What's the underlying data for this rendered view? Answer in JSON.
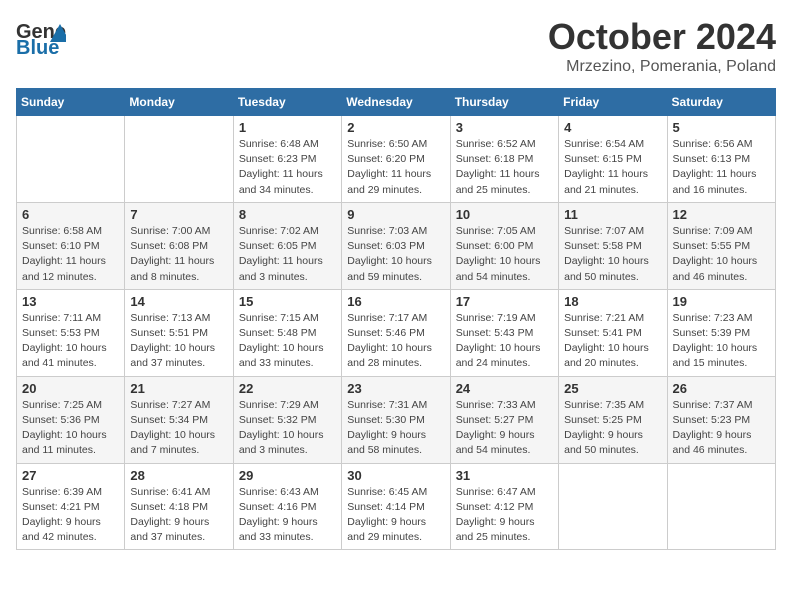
{
  "header": {
    "logo_line1": "General",
    "logo_line2": "Blue",
    "title": "October 2024",
    "subtitle": "Mrzezino, Pomerania, Poland"
  },
  "weekdays": [
    "Sunday",
    "Monday",
    "Tuesday",
    "Wednesday",
    "Thursday",
    "Friday",
    "Saturday"
  ],
  "weeks": [
    [
      {
        "day": null
      },
      {
        "day": null
      },
      {
        "day": "1",
        "sunrise": "Sunrise: 6:48 AM",
        "sunset": "Sunset: 6:23 PM",
        "daylight": "Daylight: 11 hours and 34 minutes."
      },
      {
        "day": "2",
        "sunrise": "Sunrise: 6:50 AM",
        "sunset": "Sunset: 6:20 PM",
        "daylight": "Daylight: 11 hours and 29 minutes."
      },
      {
        "day": "3",
        "sunrise": "Sunrise: 6:52 AM",
        "sunset": "Sunset: 6:18 PM",
        "daylight": "Daylight: 11 hours and 25 minutes."
      },
      {
        "day": "4",
        "sunrise": "Sunrise: 6:54 AM",
        "sunset": "Sunset: 6:15 PM",
        "daylight": "Daylight: 11 hours and 21 minutes."
      },
      {
        "day": "5",
        "sunrise": "Sunrise: 6:56 AM",
        "sunset": "Sunset: 6:13 PM",
        "daylight": "Daylight: 11 hours and 16 minutes."
      }
    ],
    [
      {
        "day": "6",
        "sunrise": "Sunrise: 6:58 AM",
        "sunset": "Sunset: 6:10 PM",
        "daylight": "Daylight: 11 hours and 12 minutes."
      },
      {
        "day": "7",
        "sunrise": "Sunrise: 7:00 AM",
        "sunset": "Sunset: 6:08 PM",
        "daylight": "Daylight: 11 hours and 8 minutes."
      },
      {
        "day": "8",
        "sunrise": "Sunrise: 7:02 AM",
        "sunset": "Sunset: 6:05 PM",
        "daylight": "Daylight: 11 hours and 3 minutes."
      },
      {
        "day": "9",
        "sunrise": "Sunrise: 7:03 AM",
        "sunset": "Sunset: 6:03 PM",
        "daylight": "Daylight: 10 hours and 59 minutes."
      },
      {
        "day": "10",
        "sunrise": "Sunrise: 7:05 AM",
        "sunset": "Sunset: 6:00 PM",
        "daylight": "Daylight: 10 hours and 54 minutes."
      },
      {
        "day": "11",
        "sunrise": "Sunrise: 7:07 AM",
        "sunset": "Sunset: 5:58 PM",
        "daylight": "Daylight: 10 hours and 50 minutes."
      },
      {
        "day": "12",
        "sunrise": "Sunrise: 7:09 AM",
        "sunset": "Sunset: 5:55 PM",
        "daylight": "Daylight: 10 hours and 46 minutes."
      }
    ],
    [
      {
        "day": "13",
        "sunrise": "Sunrise: 7:11 AM",
        "sunset": "Sunset: 5:53 PM",
        "daylight": "Daylight: 10 hours and 41 minutes."
      },
      {
        "day": "14",
        "sunrise": "Sunrise: 7:13 AM",
        "sunset": "Sunset: 5:51 PM",
        "daylight": "Daylight: 10 hours and 37 minutes."
      },
      {
        "day": "15",
        "sunrise": "Sunrise: 7:15 AM",
        "sunset": "Sunset: 5:48 PM",
        "daylight": "Daylight: 10 hours and 33 minutes."
      },
      {
        "day": "16",
        "sunrise": "Sunrise: 7:17 AM",
        "sunset": "Sunset: 5:46 PM",
        "daylight": "Daylight: 10 hours and 28 minutes."
      },
      {
        "day": "17",
        "sunrise": "Sunrise: 7:19 AM",
        "sunset": "Sunset: 5:43 PM",
        "daylight": "Daylight: 10 hours and 24 minutes."
      },
      {
        "day": "18",
        "sunrise": "Sunrise: 7:21 AM",
        "sunset": "Sunset: 5:41 PM",
        "daylight": "Daylight: 10 hours and 20 minutes."
      },
      {
        "day": "19",
        "sunrise": "Sunrise: 7:23 AM",
        "sunset": "Sunset: 5:39 PM",
        "daylight": "Daylight: 10 hours and 15 minutes."
      }
    ],
    [
      {
        "day": "20",
        "sunrise": "Sunrise: 7:25 AM",
        "sunset": "Sunset: 5:36 PM",
        "daylight": "Daylight: 10 hours and 11 minutes."
      },
      {
        "day": "21",
        "sunrise": "Sunrise: 7:27 AM",
        "sunset": "Sunset: 5:34 PM",
        "daylight": "Daylight: 10 hours and 7 minutes."
      },
      {
        "day": "22",
        "sunrise": "Sunrise: 7:29 AM",
        "sunset": "Sunset: 5:32 PM",
        "daylight": "Daylight: 10 hours and 3 minutes."
      },
      {
        "day": "23",
        "sunrise": "Sunrise: 7:31 AM",
        "sunset": "Sunset: 5:30 PM",
        "daylight": "Daylight: 9 hours and 58 minutes."
      },
      {
        "day": "24",
        "sunrise": "Sunrise: 7:33 AM",
        "sunset": "Sunset: 5:27 PM",
        "daylight": "Daylight: 9 hours and 54 minutes."
      },
      {
        "day": "25",
        "sunrise": "Sunrise: 7:35 AM",
        "sunset": "Sunset: 5:25 PM",
        "daylight": "Daylight: 9 hours and 50 minutes."
      },
      {
        "day": "26",
        "sunrise": "Sunrise: 7:37 AM",
        "sunset": "Sunset: 5:23 PM",
        "daylight": "Daylight: 9 hours and 46 minutes."
      }
    ],
    [
      {
        "day": "27",
        "sunrise": "Sunrise: 6:39 AM",
        "sunset": "Sunset: 4:21 PM",
        "daylight": "Daylight: 9 hours and 42 minutes."
      },
      {
        "day": "28",
        "sunrise": "Sunrise: 6:41 AM",
        "sunset": "Sunset: 4:18 PM",
        "daylight": "Daylight: 9 hours and 37 minutes."
      },
      {
        "day": "29",
        "sunrise": "Sunrise: 6:43 AM",
        "sunset": "Sunset: 4:16 PM",
        "daylight": "Daylight: 9 hours and 33 minutes."
      },
      {
        "day": "30",
        "sunrise": "Sunrise: 6:45 AM",
        "sunset": "Sunset: 4:14 PM",
        "daylight": "Daylight: 9 hours and 29 minutes."
      },
      {
        "day": "31",
        "sunrise": "Sunrise: 6:47 AM",
        "sunset": "Sunset: 4:12 PM",
        "daylight": "Daylight: 9 hours and 25 minutes."
      },
      {
        "day": null
      },
      {
        "day": null
      }
    ]
  ]
}
